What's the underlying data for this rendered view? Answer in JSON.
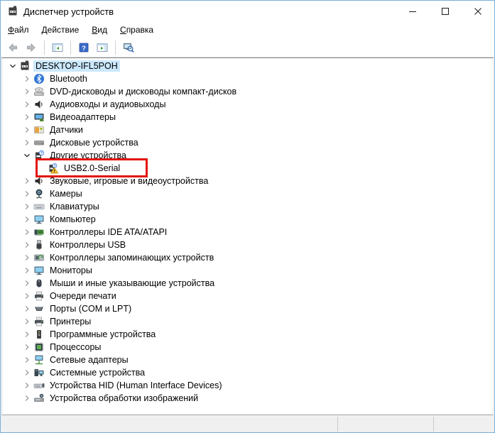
{
  "window": {
    "title": "Диспетчер устройств",
    "app_icon": "device-manager-icon",
    "controls": [
      {
        "name": "minimize-button",
        "icon": "minimize-icon"
      },
      {
        "name": "maximize-button",
        "icon": "maximize-icon"
      },
      {
        "name": "close-button",
        "icon": "close-icon"
      }
    ]
  },
  "menu": {
    "items": [
      {
        "name": "menu-file",
        "label": "Файл"
      },
      {
        "name": "menu-action",
        "label": "Действие"
      },
      {
        "name": "menu-view",
        "label": "Вид"
      },
      {
        "name": "menu-help",
        "label": "Справка"
      }
    ]
  },
  "toolbar": {
    "items": [
      {
        "type": "button",
        "name": "back-button",
        "icon": "arrow-back-icon"
      },
      {
        "type": "button",
        "name": "forward-button",
        "icon": "arrow-forward-icon"
      },
      {
        "type": "separator"
      },
      {
        "type": "button",
        "name": "show-console-tree-button",
        "icon": "console-tree-icon"
      },
      {
        "type": "separator"
      },
      {
        "type": "button",
        "name": "help-button",
        "icon": "help-icon"
      },
      {
        "type": "button",
        "name": "show-action-pane-button",
        "icon": "action-pane-icon"
      },
      {
        "type": "separator"
      },
      {
        "type": "button",
        "name": "scan-hardware-changes-button",
        "icon": "scan-hardware-icon"
      }
    ]
  },
  "tree": {
    "items": [
      {
        "label": "DESKTOP-IFL5POH",
        "level": 0,
        "state": "expanded",
        "icon": "device-manager-icon",
        "selected": true
      },
      {
        "label": "Bluetooth",
        "level": 1,
        "state": "collapsed",
        "icon": "bluetooth-icon"
      },
      {
        "label": "DVD-дисководы и дисководы компакт-дисков",
        "level": 1,
        "state": "collapsed",
        "icon": "disc-drive-icon"
      },
      {
        "label": "Аудиовходы и аудиовыходы",
        "level": 1,
        "state": "collapsed",
        "icon": "speaker-icon"
      },
      {
        "label": "Видеоадаптеры",
        "level": 1,
        "state": "collapsed",
        "icon": "display-adapter-icon"
      },
      {
        "label": "Датчики",
        "level": 1,
        "state": "collapsed",
        "icon": "sensors-icon"
      },
      {
        "label": "Дисковые устройства",
        "level": 1,
        "state": "collapsed",
        "icon": "disk-icon"
      },
      {
        "label": "Другие устройства",
        "level": 1,
        "state": "expanded",
        "icon": "unknown-device-icon"
      },
      {
        "label": "USB2.0-Serial",
        "level": 2,
        "state": "leaf",
        "icon": "usb-warning-icon",
        "red_box": true
      },
      {
        "label": "Звуковые, игровые и видеоустройства",
        "level": 1,
        "state": "collapsed",
        "icon": "speaker-icon"
      },
      {
        "label": "Камеры",
        "level": 1,
        "state": "collapsed",
        "icon": "camera-icon"
      },
      {
        "label": "Клавиатуры",
        "level": 1,
        "state": "collapsed",
        "icon": "keyboard-icon"
      },
      {
        "label": "Компьютер",
        "level": 1,
        "state": "collapsed",
        "icon": "monitor-icon"
      },
      {
        "label": "Контроллеры IDE ATA/ATAPI",
        "level": 1,
        "state": "collapsed",
        "icon": "ide-controller-icon"
      },
      {
        "label": "Контроллеры USB",
        "level": 1,
        "state": "collapsed",
        "icon": "usb-plug-icon"
      },
      {
        "label": "Контроллеры запоминающих устройств",
        "level": 1,
        "state": "collapsed",
        "icon": "storage-controller-icon"
      },
      {
        "label": "Мониторы",
        "level": 1,
        "state": "collapsed",
        "icon": "monitor-icon"
      },
      {
        "label": "Мыши и иные указывающие устройства",
        "level": 1,
        "state": "collapsed",
        "icon": "mouse-icon"
      },
      {
        "label": "Очереди печати",
        "level": 1,
        "state": "collapsed",
        "icon": "printer-icon"
      },
      {
        "label": "Порты (COM и LPT)",
        "level": 1,
        "state": "collapsed",
        "icon": "com-port-icon"
      },
      {
        "label": "Принтеры",
        "level": 1,
        "state": "collapsed",
        "icon": "printer-icon"
      },
      {
        "label": "Программные устройства",
        "level": 1,
        "state": "collapsed",
        "icon": "software-device-icon"
      },
      {
        "label": "Процессоры",
        "level": 1,
        "state": "collapsed",
        "icon": "cpu-icon"
      },
      {
        "label": "Сетевые адаптеры",
        "level": 1,
        "state": "collapsed",
        "icon": "network-adapter-icon"
      },
      {
        "label": "Системные устройства",
        "level": 1,
        "state": "collapsed",
        "icon": "system-devices-icon"
      },
      {
        "label": "Устройства HID (Human Interface Devices)",
        "level": 1,
        "state": "collapsed",
        "icon": "hid-icon"
      },
      {
        "label": "Устройства обработки изображений",
        "level": 1,
        "state": "collapsed",
        "icon": "imaging-device-icon"
      }
    ]
  },
  "status_bar": {
    "text": ""
  },
  "colors": {
    "window_border": "#79aedc",
    "selection": "#cbe8fc",
    "annotation_red": "#e3140b",
    "warning_yellow": "#fbc02d",
    "help_blue": "#3a6bc9"
  }
}
